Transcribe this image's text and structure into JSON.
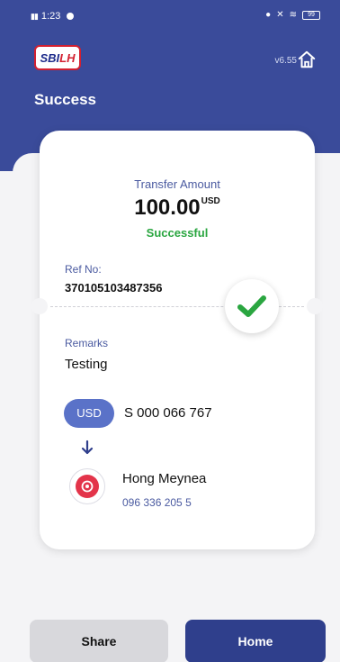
{
  "status_bar": {
    "time": "1:23",
    "battery": "99"
  },
  "header": {
    "logo_primary": "SBI",
    "logo_secondary": "LH",
    "version": "v6.55",
    "title": "Success"
  },
  "receipt": {
    "amount_label": "Transfer Amount",
    "amount": "100.00",
    "currency": "USD",
    "status": "Successful",
    "ref_label": "Ref No:",
    "ref_value": "370105103487356",
    "remarks_label": "Remarks",
    "remarks_value": "Testing",
    "from_currency": "USD",
    "from_account": "S 000 066 767",
    "payee_name": "Hong Meynea",
    "payee_phone": "096 336 205 5"
  },
  "actions": {
    "share_label": "Share",
    "home_label": "Home"
  },
  "icons": {
    "home": "home-icon",
    "check": "check-icon",
    "arrow": "arrow-down-icon",
    "avatar": "bank-logo-icon"
  },
  "colors": {
    "header_bg": "#3a4b9a",
    "success": "#2aa640",
    "primary_button": "#2f3f8c",
    "pill": "#5a72c8"
  }
}
